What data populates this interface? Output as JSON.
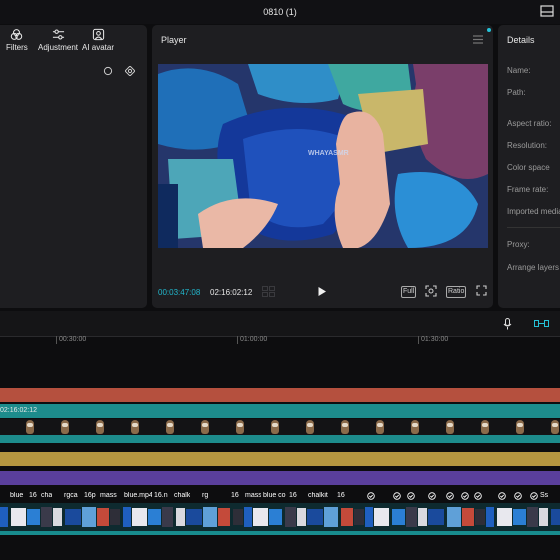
{
  "window": {
    "title": "0810 (1)",
    "layout_icon": "layout-icon"
  },
  "left_panel": {
    "tools": [
      {
        "label": "Filters",
        "icon": "filters-icon"
      },
      {
        "label": "Adjustment",
        "icon": "adjustment-icon"
      },
      {
        "label": "AI avatar",
        "icon": "avatar-icon"
      }
    ],
    "icons": [
      "refresh-icon",
      "settings-icon"
    ]
  },
  "player": {
    "title": "Player",
    "current_time": "00:03:47:08",
    "total_time": "02:16:02:12",
    "full_label": "Full",
    "ratio_label": "Ratio",
    "watermark": "WHAYASMR",
    "accent_color": "#22b7cc"
  },
  "details": {
    "title": "Details",
    "labels": [
      "Name:",
      "Path:",
      "Aspect ratio:",
      "Resolution:",
      "Color space",
      "Frame rate:",
      "Imported media",
      "Proxy:",
      "Arrange layers"
    ]
  },
  "timeline": {
    "ruler_ticks": [
      "00:30:00",
      "01:00:00",
      "01:30:00"
    ],
    "track_time_label": "02:16:02:12",
    "clip_labels": [
      "blue",
      "16",
      "cha",
      "rgca",
      "16p",
      "mass",
      "blue.mp4",
      "16.n",
      "chalk",
      "rg",
      "16",
      "mass",
      "blue co",
      "16",
      "chalkit",
      "16"
    ],
    "end_label": "Ss",
    "track_colors": {
      "red": "#b5503e",
      "teal": "#1d8c8c",
      "gold": "#b59640",
      "purple": "#5a3f9c"
    }
  }
}
